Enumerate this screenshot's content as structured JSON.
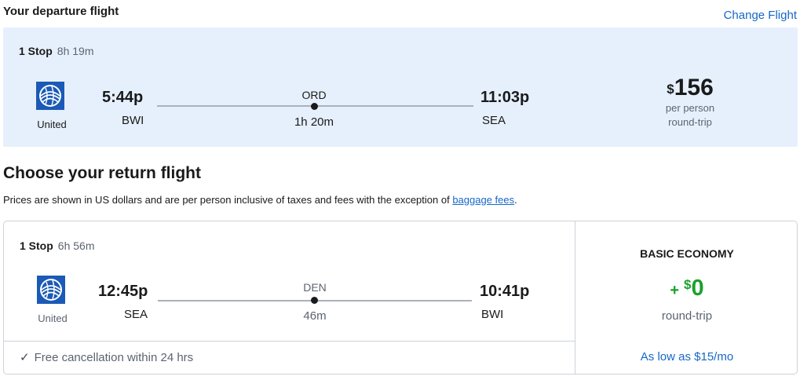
{
  "departure": {
    "title": "Your departure flight",
    "change_label": "Change Flight",
    "stops": "1 Stop",
    "duration": "8h 19m",
    "airline": "United",
    "depart_time": "5:44p",
    "depart_airport": "BWI",
    "layover_airport": "ORD",
    "layover_duration": "1h 20m",
    "arrive_time": "11:03p",
    "arrive_airport": "SEA",
    "price_currency": "$",
    "price_amount": "156",
    "price_per": "per person",
    "price_trip": "round-trip"
  },
  "return_section": {
    "heading": "Choose your return flight",
    "disclaimer_text": "Prices are shown in US dollars and are per person inclusive of taxes and fees with the exception of ",
    "disclaimer_link": "baggage fees",
    "disclaimer_end": "."
  },
  "return_flight": {
    "stops": "1 Stop",
    "duration": "6h 56m",
    "airline": "United",
    "depart_time": "12:45p",
    "depart_airport": "SEA",
    "layover_airport": "DEN",
    "layover_duration": "46m",
    "arrive_time": "10:41p",
    "arrive_airport": "BWI",
    "free_cancellation": "Free cancellation within 24 hrs",
    "fare_class": "BASIC ECONOMY",
    "fare_plus": "+",
    "fare_currency": "$",
    "fare_amount": "0",
    "fare_trip": "round-trip",
    "financing": "As low as $15/mo"
  },
  "colors": {
    "accent_blue": "#1668c7",
    "price_green": "#1aa22b",
    "card_bg": "#e6f0fd"
  },
  "icons": {
    "airline_logo": "united-globe-icon",
    "check": "check-icon"
  }
}
